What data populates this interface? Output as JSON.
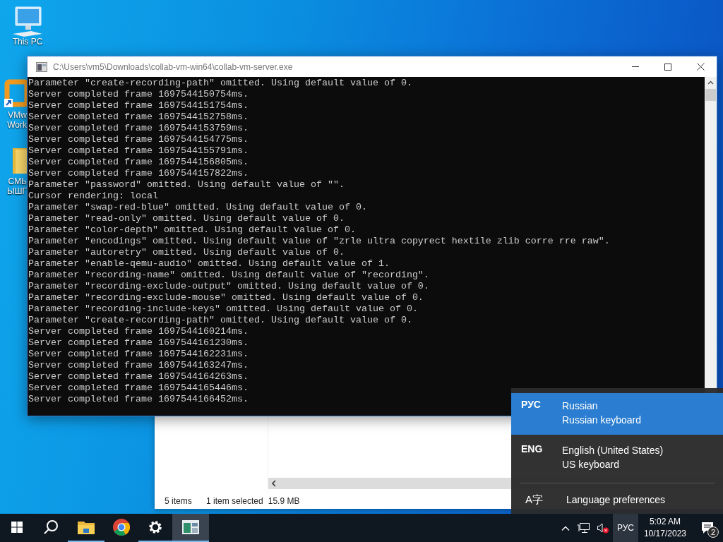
{
  "desktop_icons": [
    {
      "kind": "computer",
      "lines": [
        "This PC"
      ]
    },
    {
      "kind": "shortcut",
      "lines": [
        "VMw",
        "Work"
      ]
    },
    {
      "kind": "folder",
      "lines": [
        "СМЬ",
        "ЫШГ"
      ]
    }
  ],
  "console_window": {
    "title": "C:\\Users\\vm5\\Downloads\\collab-vm-win64\\collab-vm-server.exe",
    "lines": [
      "Parameter \"create-recording-path\" omitted. Using default value of 0.",
      "Server completed frame 1697544150754ms.",
      "Server completed frame 1697544151754ms.",
      "Server completed frame 1697544152758ms.",
      "Server completed frame 1697544153759ms.",
      "Server completed frame 1697544154775ms.",
      "Server completed frame 1697544155791ms.",
      "Server completed frame 1697544156805ms.",
      "Server completed frame 1697544157822ms.",
      "Parameter \"password\" omitted. Using default value of \"\".",
      "Cursor rendering: local",
      "Parameter \"swap-red-blue\" omitted. Using default value of 0.",
      "Parameter \"read-only\" omitted. Using default value of 0.",
      "Parameter \"color-depth\" omitted. Using default value of 0.",
      "Parameter \"encodings\" omitted. Using default value of \"zrle ultra copyrect hextile zlib corre rre raw\".",
      "Parameter \"autoretry\" omitted. Using default value of 0.",
      "Parameter \"enable-qemu-audio\" omitted. Using default value of 1.",
      "Parameter \"recording-name\" omitted. Using default value of \"recording\".",
      "Parameter \"recording-exclude-output\" omitted. Using default value of 0.",
      "Parameter \"recording-exclude-mouse\" omitted. Using default value of 0.",
      "Parameter \"recording-include-keys\" omitted. Using default value of 0.",
      "Parameter \"create-recording-path\" omitted. Using default value of 0.",
      "Server completed frame 1697544160214ms.",
      "Server completed frame 1697544161230ms.",
      "Server completed frame 1697544162231ms.",
      "Server completed frame 1697544163247ms.",
      "Server completed frame 1697544164263ms.",
      "Server completed frame 1697544165446ms.",
      "Server completed frame 1697544166452ms."
    ]
  },
  "explorer_window": {
    "status_bar": [
      "5 items",
      "1 item selected",
      "15.9 MB"
    ]
  },
  "language_flyout": {
    "items": [
      {
        "code": "РУС",
        "name": "Russian",
        "keyboard": "Russian keyboard",
        "selected": true
      },
      {
        "code": "ENG",
        "name": "English (United States)",
        "keyboard": "US keyboard",
        "selected": false
      }
    ],
    "preferences_icon": "A字",
    "preferences": "Language preferences"
  },
  "taskbar": {
    "apps": [
      {
        "kind": "start",
        "running": false,
        "active": false
      },
      {
        "kind": "search",
        "running": false,
        "active": false
      },
      {
        "kind": "explorer",
        "running": true,
        "active": false
      },
      {
        "kind": "browser",
        "running": false,
        "active": false
      },
      {
        "kind": "settings",
        "running": true,
        "active": false
      },
      {
        "kind": "console",
        "running": true,
        "active": true
      }
    ],
    "input_indicator": "РУС",
    "time": "5:02 AM",
    "date": "10/17/2023",
    "notifications": "2"
  }
}
